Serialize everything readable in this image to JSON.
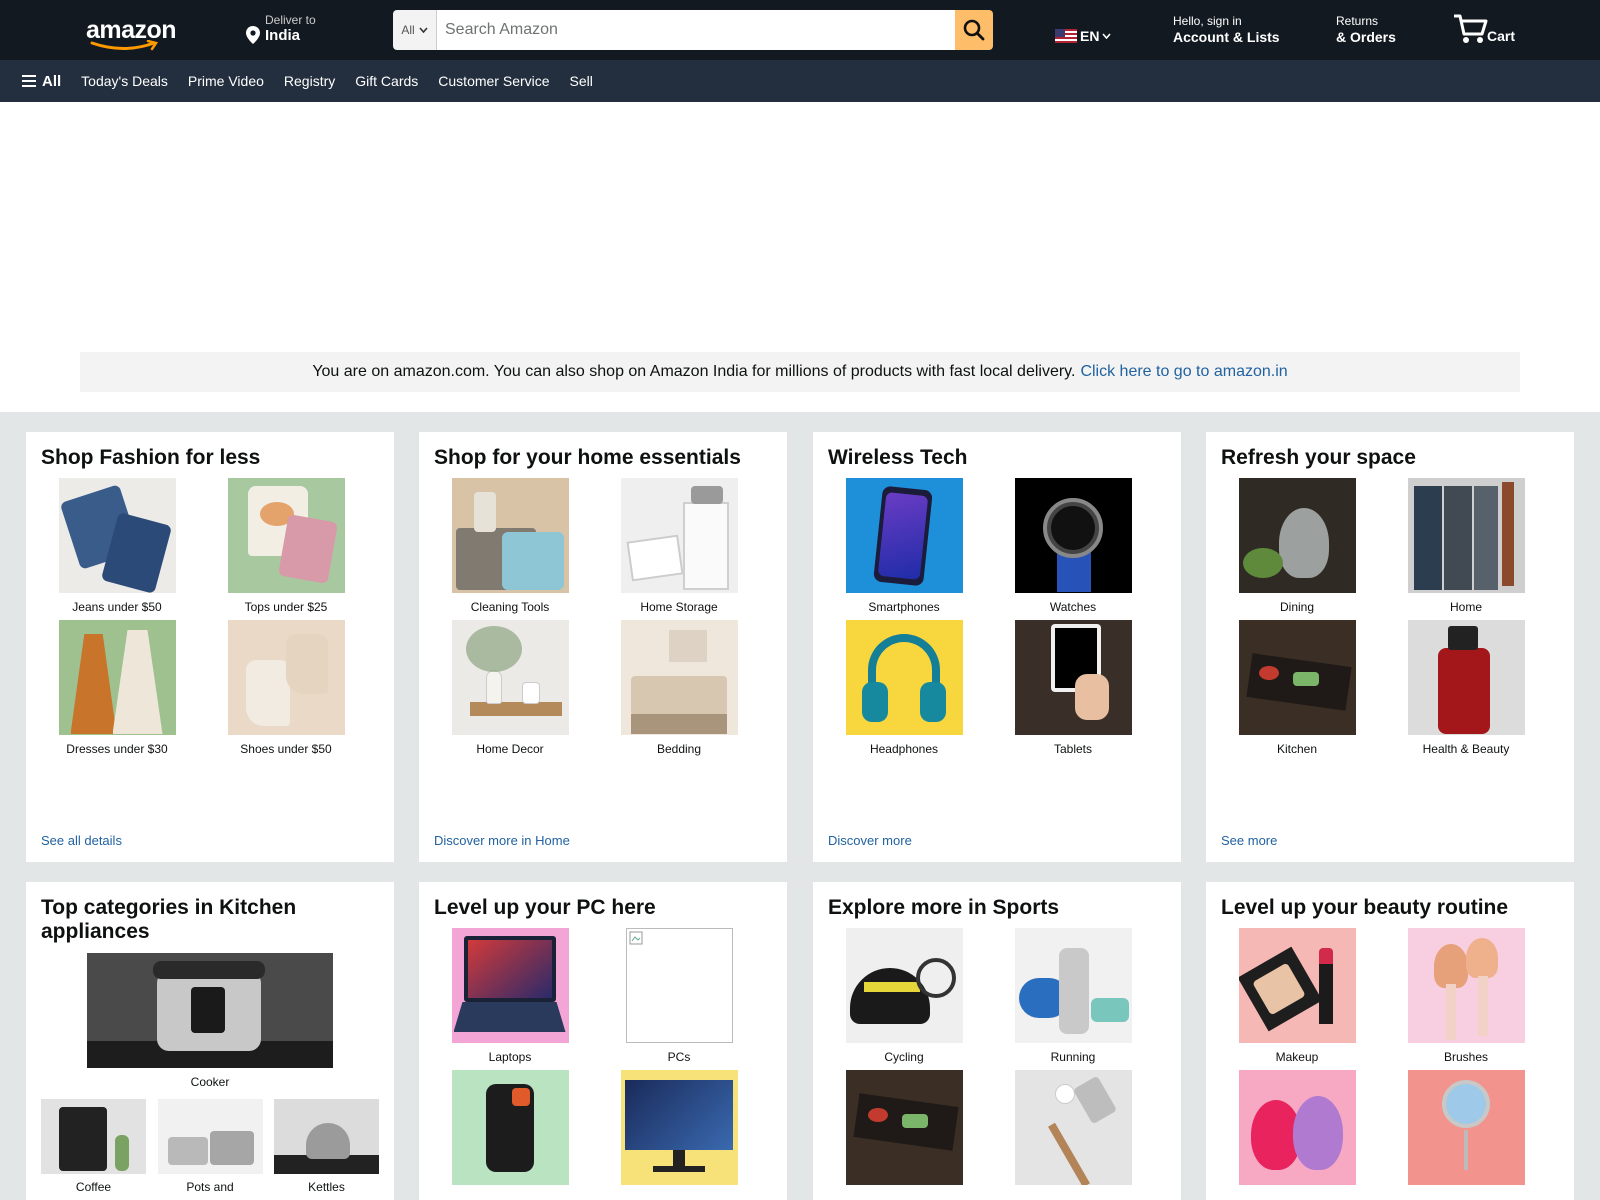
{
  "header": {
    "logo": "amazon",
    "deliver_line1": "Deliver to",
    "deliver_line2": "India",
    "search_category": "All",
    "search_placeholder": "Search Amazon",
    "language": "EN",
    "account_line1": "Hello, sign in",
    "account_line2": "Account & Lists",
    "returns_line1": "Returns",
    "returns_line2": "& Orders",
    "cart_label": "Cart"
  },
  "subnav": {
    "all_label": "All",
    "items": [
      "Today's Deals",
      "Prime Video",
      "Registry",
      "Gift Cards",
      "Customer Service",
      "Sell"
    ]
  },
  "banner": {
    "text": "You are on amazon.com. You can also shop on Amazon India for millions of products with fast local delivery.",
    "link": "Click here to go to amazon.in"
  },
  "cards": [
    {
      "title": "Shop Fashion for less",
      "tiles": [
        "Jeans under $50",
        "Tops under $25",
        "Dresses under $30",
        "Shoes under $50"
      ],
      "link": "See all details"
    },
    {
      "title": "Shop for your home essentials",
      "tiles": [
        "Cleaning Tools",
        "Home Storage",
        "Home Decor",
        "Bedding"
      ],
      "link": "Discover more in Home"
    },
    {
      "title": "Wireless Tech",
      "tiles": [
        "Smartphones",
        "Watches",
        "Headphones",
        "Tablets"
      ],
      "link": "Discover more"
    },
    {
      "title": "Refresh your space",
      "tiles": [
        "Dining",
        "Home",
        "Kitchen",
        "Health & Beauty"
      ],
      "link": "See more"
    },
    {
      "title": "Top categories in Kitchen appliances",
      "main_tile": "Cooker",
      "tiles": [
        "Coffee",
        "Pots and",
        "Kettles"
      ]
    },
    {
      "title": "Level up your PC here",
      "tiles": [
        "Laptops",
        "PCs"
      ]
    },
    {
      "title": "Explore more in Sports",
      "tiles": [
        "Cycling",
        "Running"
      ]
    },
    {
      "title": "Level up your beauty routine",
      "tiles": [
        "Makeup",
        "Brushes"
      ]
    }
  ],
  "colors": {
    "nav_dark": "#131921",
    "nav_sub": "#232f3e",
    "search_button": "#febd69",
    "link": "#2162a1",
    "page_gray": "#e3e6e6"
  }
}
